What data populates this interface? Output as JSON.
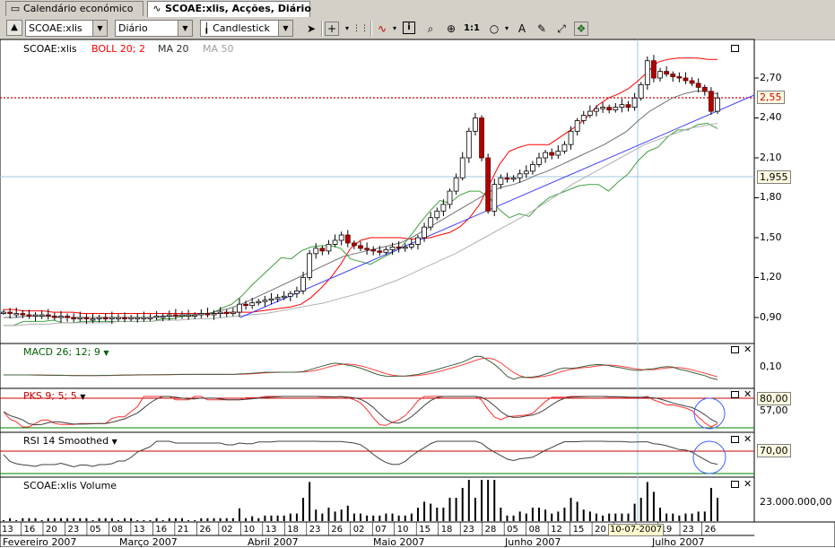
{
  "tabs": [
    {
      "label": "Calendário económico",
      "icon": "calendar-icon"
    },
    {
      "label": "SCOAE:xlis, Acções, Diário",
      "icon": "chart-icon"
    }
  ],
  "toolbar": {
    "symbol_value": "SCOAE:xlis",
    "period_value": "Diário",
    "chart_type_value": "Candlestick",
    "zoom_label": "1:1"
  },
  "panels": {
    "price": {
      "label_symbol": "SCOAE:xlis",
      "label_boll": "BOLL 20; 2",
      "label_ma20": "MA 20",
      "label_ma50": "MA 50",
      "y_ticks": [
        "2,70",
        "2,40",
        "2,10",
        "1,80",
        "1,50",
        "1,20",
        "0,90"
      ],
      "last_price": "2,55",
      "cursor_value": "1,955",
      "colors": {
        "boll": "#ff0000",
        "ma20": "#707070",
        "ma50": "#a8a8a8",
        "trend": "#4040ff",
        "last": "#cc0000"
      }
    },
    "macd": {
      "label": "MACD 26; 12; 9",
      "y_tick": "0,10"
    },
    "pks": {
      "label": "PKS 9; 5; 5",
      "y_box": "80,00",
      "y_tick": "57,00"
    },
    "rsi": {
      "label": "RSI 14 Smoothed",
      "y_box": "70,00"
    },
    "volume": {
      "label": "SCOAE:xlis Volume",
      "y_tick": "23.000.000,00"
    }
  },
  "x_axis": {
    "days": [
      "13",
      "16",
      "20",
      "23",
      "05",
      "08",
      "13",
      "16",
      "21",
      "26",
      "02",
      "10",
      "13",
      "18",
      "23",
      "26",
      "02",
      "07",
      "10",
      "15",
      "18",
      "23",
      "28",
      "05",
      "08",
      "12",
      "15",
      "20",
      "25",
      "16",
      "19",
      "23",
      "26"
    ],
    "cursor_date": "10-07-2007",
    "months": [
      "Fevereiro 2007",
      "Março 2007",
      "Abril 2007",
      "Maio 2007",
      "Junho 2007",
      "Julho 2007"
    ]
  },
  "chart_data": {
    "type": "candlestick",
    "title": "SCOAE:xlis",
    "period": "Diário",
    "ylim": [
      0.8,
      2.9
    ],
    "close": [
      0.94,
      0.93,
      0.93,
      0.92,
      0.91,
      0.92,
      0.92,
      0.91,
      0.9,
      0.91,
      0.9,
      0.89,
      0.9,
      0.89,
      0.89,
      0.9,
      0.89,
      0.9,
      0.9,
      0.89,
      0.9,
      0.9,
      0.9,
      0.9,
      0.91,
      0.91,
      0.92,
      0.91,
      0.92,
      0.92,
      0.92,
      0.93,
      0.92,
      0.93,
      0.94,
      0.93,
      0.94,
      1.0,
      0.99,
      1.01,
      1.02,
      1.03,
      1.04,
      1.05,
      1.06,
      1.08,
      1.1,
      1.2,
      1.38,
      1.42,
      1.4,
      1.45,
      1.48,
      1.52,
      1.46,
      1.44,
      1.42,
      1.41,
      1.4,
      1.39,
      1.41,
      1.43,
      1.42,
      1.43,
      1.45,
      1.5,
      1.58,
      1.65,
      1.7,
      1.75,
      1.85,
      1.95,
      2.1,
      2.3,
      2.4,
      2.1,
      1.7,
      1.9,
      1.95,
      1.94,
      1.95,
      1.98,
      2.0,
      2.05,
      2.1,
      2.14,
      2.12,
      2.15,
      2.2,
      2.3,
      2.38,
      2.42,
      2.45,
      2.47,
      2.48,
      2.46,
      2.48,
      2.5,
      2.48,
      2.55,
      2.65,
      2.83,
      2.7,
      2.75,
      2.73,
      2.71,
      2.7,
      2.68,
      2.66,
      2.63,
      2.6,
      2.45,
      2.55
    ],
    "bollinger_upper": [
      0.96,
      0.96,
      0.95,
      0.95,
      0.95,
      0.94,
      0.94,
      0.94,
      0.93,
      0.93,
      0.93,
      0.93,
      0.93,
      0.93,
      0.93,
      0.93,
      0.93,
      0.93,
      0.93,
      0.93,
      0.93,
      0.93,
      0.93,
      0.94,
      0.94,
      0.94,
      0.95,
      0.96,
      0.97,
      0.98,
      1.0,
      1.05,
      1.12,
      1.2,
      1.3,
      1.42,
      1.48,
      1.5,
      1.5,
      1.5,
      1.5,
      1.49,
      1.49,
      1.5,
      1.52,
      1.54,
      1.58,
      1.65,
      1.75,
      1.9,
      2.05,
      2.15,
      2.18,
      2.2,
      2.2,
      2.2,
      2.25,
      2.3,
      2.35,
      2.42,
      2.5,
      2.55,
      2.58,
      2.62,
      2.68,
      2.75,
      2.82,
      2.84,
      2.85,
      2.85,
      2.85,
      2.84,
      2.84
    ],
    "ma20": [
      0.9,
      0.9,
      0.91,
      0.91,
      0.91,
      0.9,
      0.9,
      0.9,
      0.9,
      0.9,
      0.9,
      0.9,
      0.9,
      0.9,
      0.91,
      0.91,
      0.92,
      0.92,
      0.93,
      0.95,
      0.97,
      1.0,
      1.04,
      1.08,
      1.12,
      1.16,
      1.2,
      1.24,
      1.28,
      1.32,
      1.36,
      1.38,
      1.4,
      1.42,
      1.44,
      1.46,
      1.5,
      1.55,
      1.6,
      1.65,
      1.7,
      1.75,
      1.8,
      1.85,
      1.88,
      1.9,
      1.93,
      1.97,
      2.0,
      2.04,
      2.08,
      2.12,
      2.16,
      2.2,
      2.25,
      2.3,
      2.38,
      2.45,
      2.5,
      2.55,
      2.58,
      2.6,
      2.6,
      2.58
    ],
    "ma50": [
      0.84,
      0.84,
      0.85,
      0.85,
      0.86,
      0.86,
      0.86,
      0.86,
      0.87,
      0.87,
      0.87,
      0.88,
      0.88,
      0.89,
      0.89,
      0.9,
      0.91,
      0.92,
      0.93,
      0.95,
      0.97,
      0.99,
      1.01,
      1.04,
      1.07,
      1.1,
      1.14,
      1.18,
      1.23,
      1.28,
      1.33,
      1.38,
      1.44,
      1.5,
      1.56,
      1.62,
      1.68,
      1.75,
      1.82,
      1.9,
      1.96,
      2.02,
      2.08,
      2.14,
      2.2,
      2.24,
      2.28,
      2.32,
      2.34,
      2.36
    ],
    "trend_line": {
      "from": [
        0,
        0.91
      ],
      "to": [
        1,
        2.58
      ]
    },
    "last_price": 2.55,
    "cursor": {
      "date": "10-07-2007",
      "value": 1.955
    }
  }
}
